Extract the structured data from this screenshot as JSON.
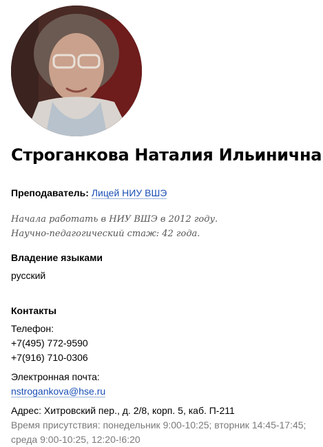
{
  "person": {
    "name": "Строганкова Наталия Ильинична",
    "role_label": "Преподаватель:",
    "role_link": "Лицей НИУ ВШЭ",
    "bio_line1": "Начала работать в НИУ ВШЭ в 2012 году.",
    "bio_line2": "Научно-педагогический стаж: 42 года."
  },
  "languages": {
    "heading": "Владение языками",
    "value": "русский"
  },
  "contacts": {
    "heading": "Контакты",
    "phone_label": "Телефон:",
    "phones": [
      "+7(495) 772-9590",
      "+7(916) 710-0306"
    ],
    "email_label": "Электронная почта:",
    "email": "nstrogankova@hse.ru",
    "address": "Адрес: Хитровский пер., д. 2/8, корп. 5, каб. П-211",
    "hours_line1": "Время присутствия: понедельник 9:00-10:25; вторник 14:45-17:45;",
    "hours_line2": "среда 9:00-10:25, 12:20-!6:20"
  },
  "colors": {
    "link": "#1a4fb6",
    "muted": "#7a7a7a"
  }
}
